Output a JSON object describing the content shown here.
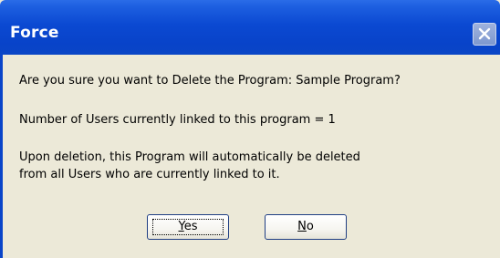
{
  "window": {
    "title": "Force",
    "close_icon": "close-icon"
  },
  "message": {
    "line1": "Are you sure you want to Delete the Program: Sample Program?",
    "line2": "Number of Users currently linked to this program = 1",
    "line3": "Upon deletion, this Program will automatically be deleted",
    "line4": "from all Users who are currently linked to it."
  },
  "buttons": {
    "yes": {
      "accesskey": "Y",
      "rest": "es"
    },
    "no": {
      "accesskey": "N",
      "rest": "o"
    }
  }
}
